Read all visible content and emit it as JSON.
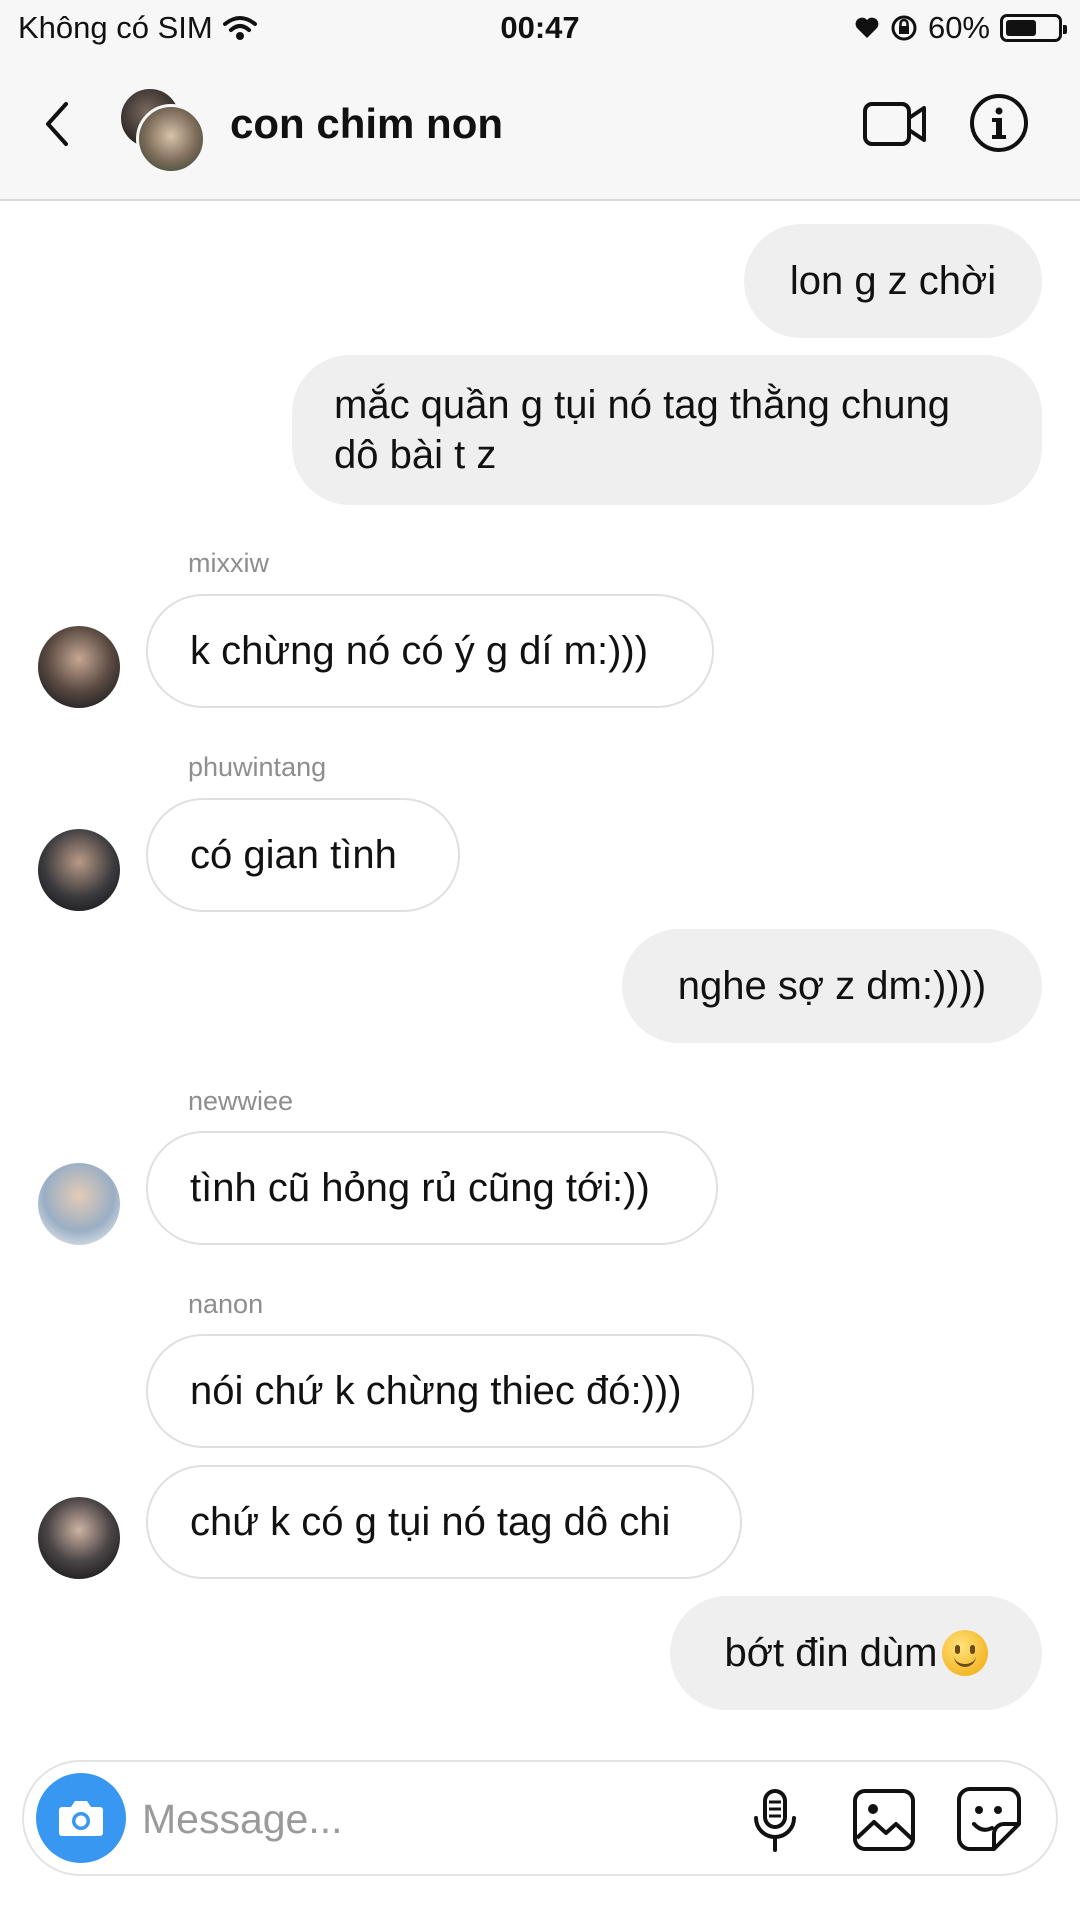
{
  "status_bar": {
    "carrier": "Không có SIM",
    "time": "00:47",
    "battery_text": "60%",
    "battery_level": 0.6
  },
  "header": {
    "title": "con chim non"
  },
  "messages": [
    {
      "direction": "out",
      "text": "lon g z chời"
    },
    {
      "direction": "out",
      "text_line1": "mắc quần g tụi nó tag thằng chung",
      "text_line2": "dô bài t z"
    },
    {
      "direction": "in",
      "sender": "mixxiw",
      "text": "k chừng nó có ý g dí m:)))"
    },
    {
      "direction": "in",
      "sender": "phuwintang",
      "text": "có gian tình"
    },
    {
      "direction": "out",
      "text": "nghe sợ z dm:))))"
    },
    {
      "direction": "in",
      "sender": "newwiee",
      "text": "tình cũ hỏng rủ cũng tới:))"
    },
    {
      "direction": "in",
      "sender": "nanon",
      "text": "nói chứ k chừng thiec đó:)))"
    },
    {
      "direction": "in",
      "text": "chứ k có g tụi nó tag dô chi"
    },
    {
      "direction": "out",
      "text": "bớt đin dùm",
      "emoji": "slightly-smiling-face"
    }
  ],
  "composer": {
    "placeholder": "Message..."
  },
  "colors": {
    "accent": "#3897f0",
    "outgoing_bubble": "#efefef",
    "sender_name": "#8e8e8e"
  },
  "icons": [
    "wifi-icon",
    "heart-icon",
    "rotation-lock-icon",
    "battery-icon",
    "back-icon",
    "video-call-icon",
    "info-icon",
    "camera-icon",
    "mic-icon",
    "gallery-icon",
    "sticker-icon"
  ]
}
